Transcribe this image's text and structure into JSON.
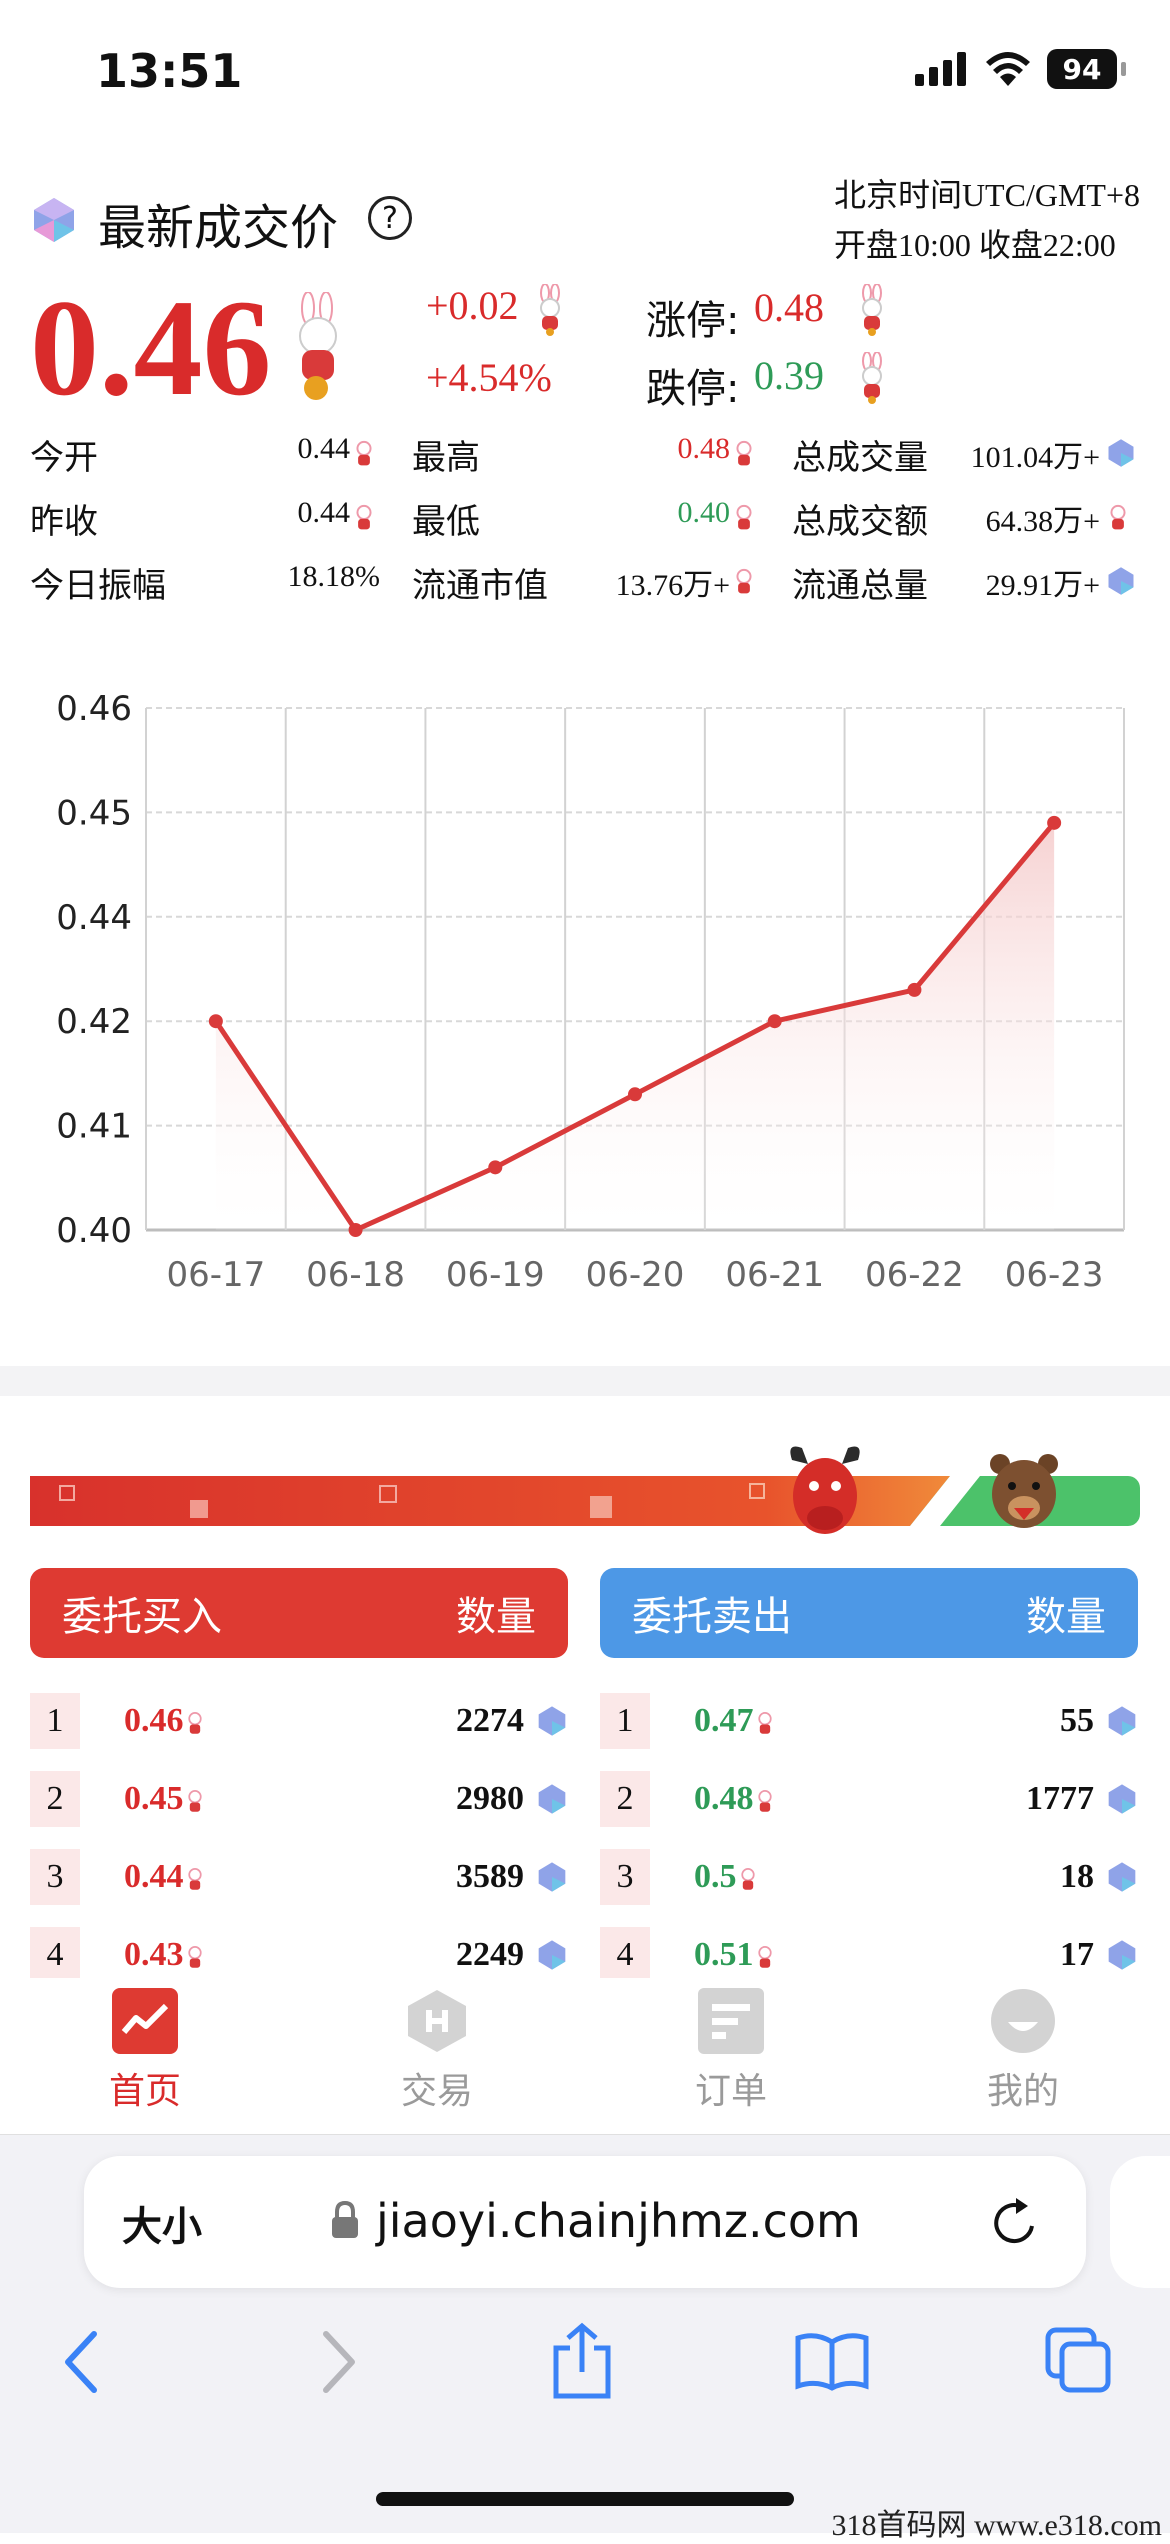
{
  "status_bar": {
    "time": "13:51",
    "battery": "94"
  },
  "header": {
    "title": "最新成交价",
    "help_glyph": "?",
    "timezone_line1": "北京时间UTC/GMT+8",
    "timezone_line2": "开盘10:00 收盘22:00"
  },
  "price": {
    "current": "0.46",
    "change_abs": "+0.02",
    "change_pct": "+4.54%",
    "limit_up_label": "涨停:",
    "limit_up": "0.48",
    "limit_down_label": "跌停:",
    "limit_down": "0.39"
  },
  "stats": {
    "open_label": "今开",
    "open": "0.44",
    "prev_close_label": "昨收",
    "prev_close": "0.44",
    "amplitude_label": "今日振幅",
    "amplitude": "18.18%",
    "high_label": "最高",
    "high": "0.48",
    "low_label": "最低",
    "low": "0.40",
    "market_cap_label": "流通市值",
    "market_cap": "13.76万+",
    "volume_label": "总成交量",
    "volume": "101.04万+",
    "turnover_label": "总成交额",
    "turnover": "64.38万+",
    "circulating_label": "流通总量",
    "circulating": "29.91万+"
  },
  "chart_data": {
    "type": "line",
    "x": [
      "06-17",
      "06-18",
      "06-19",
      "06-20",
      "06-21",
      "06-22",
      "06-23"
    ],
    "values": [
      0.42,
      0.4,
      0.406,
      0.413,
      0.42,
      0.426,
      0.449
    ],
    "y_ticks": [
      "0.46",
      "0.45",
      "0.44",
      "0.42",
      "0.41",
      "0.40"
    ],
    "grid": true,
    "line_color": "#d93a3a"
  },
  "orderbook": {
    "buy_title": "委托买入",
    "sell_title": "委托卖出",
    "qty_label": "数量",
    "buy": [
      {
        "idx": "1",
        "price": "0.46",
        "qty": "2274"
      },
      {
        "idx": "2",
        "price": "0.45",
        "qty": "2980"
      },
      {
        "idx": "3",
        "price": "0.44",
        "qty": "3589"
      },
      {
        "idx": "4",
        "price": "0.43",
        "qty": "2249"
      }
    ],
    "sell": [
      {
        "idx": "1",
        "price": "0.47",
        "qty": "55"
      },
      {
        "idx": "2",
        "price": "0.48",
        "qty": "1777"
      },
      {
        "idx": "3",
        "price": "0.5",
        "qty": "18"
      },
      {
        "idx": "4",
        "price": "0.51",
        "qty": "17"
      }
    ]
  },
  "tabs": [
    {
      "label": "首页",
      "icon": "chart-icon"
    },
    {
      "label": "交易",
      "icon": "trade-icon"
    },
    {
      "label": "订单",
      "icon": "order-icon"
    },
    {
      "label": "我的",
      "icon": "profile-icon"
    }
  ],
  "browser": {
    "text_size": "大小",
    "url": "jiaoyi.chainjhmz.com"
  },
  "watermark": "318首码网 www.e318.com",
  "colors": {
    "up": "#d92b2b",
    "down": "#2e9b57",
    "buy_header": "#de3a32",
    "sell_header": "#4d98e6"
  }
}
